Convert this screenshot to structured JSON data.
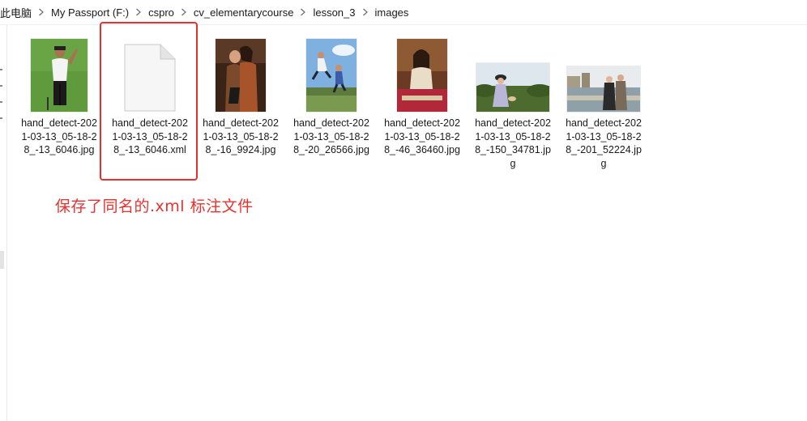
{
  "breadcrumb": {
    "items": [
      "此电脑",
      "My Passport (F:)",
      "cspro",
      "cv_elementarycourse",
      "lesson_3",
      "images"
    ]
  },
  "files": [
    {
      "name": "hand_detect-2021-03-13_05-18-28_-13_6046.jpg",
      "icon": "photo-thumbnail",
      "subject": "golfer"
    },
    {
      "name": "hand_detect-2021-03-13_05-18-28_-13_6046.xml",
      "icon": "document-file-icon",
      "subject": "blank document"
    },
    {
      "name": "hand_detect-2021-03-13_05-18-28_-16_9924.jpg",
      "icon": "photo-thumbnail",
      "subject": "couple"
    },
    {
      "name": "hand_detect-2021-03-13_05-18-28_-20_26566.jpg",
      "icon": "photo-thumbnail",
      "subject": "jumping people"
    },
    {
      "name": "hand_detect-2021-03-13_05-18-28_-46_36460.jpg",
      "icon": "photo-thumbnail",
      "subject": "woman seated"
    },
    {
      "name": "hand_detect-2021-03-13_05-18-28_-150_34781.jpg",
      "icon": "photo-thumbnail",
      "subject": "woman in garden"
    },
    {
      "name": "hand_detect-2021-03-13_05-18-28_-201_52224.jpg",
      "icon": "photo-thumbnail",
      "subject": "couple by river"
    }
  ],
  "annotation": {
    "text": "保存了同名的.xml 标注文件",
    "color": "#e8312f"
  },
  "colors": {
    "accent": "#e8312f",
    "text": "#1a1a1a"
  }
}
